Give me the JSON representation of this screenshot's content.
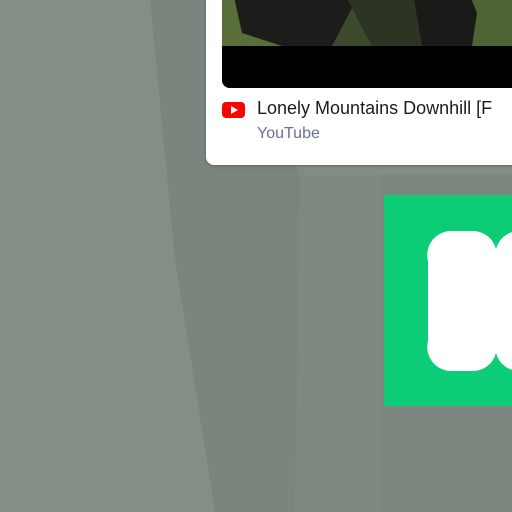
{
  "desktop": {
    "background_color": "#7f8a82"
  },
  "link_preview": {
    "title": "Lonely Mountains Downhill [F",
    "source": "YouTube",
    "source_icon": "youtube-play-icon",
    "source_icon_color": "#ff0000",
    "source_color": "#6a6f98"
  },
  "app_tile": {
    "icon": "app-logo-icon",
    "color": "#0dcc76"
  }
}
